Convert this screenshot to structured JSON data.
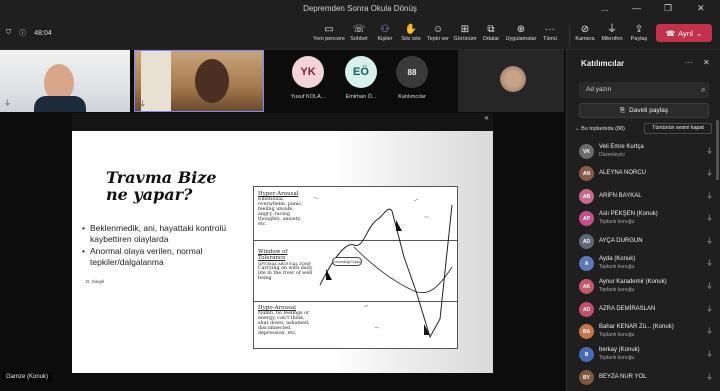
{
  "window": {
    "title": "Depremden Sonra Okula Dönüş",
    "controls": [
      "...",
      "—",
      "❐",
      "✕"
    ]
  },
  "toolbar": {
    "timer": "48:04",
    "items": [
      {
        "label": "Yeni pencere",
        "icon": "new-window-icon"
      },
      {
        "label": "Sohbet",
        "icon": "chat-icon"
      },
      {
        "label": "Kişiler",
        "icon": "people-icon"
      },
      {
        "label": "Söz iste",
        "icon": "raise-hand-icon"
      },
      {
        "label": "Tepki ver",
        "icon": "react-icon"
      },
      {
        "label": "Görünüm",
        "icon": "view-icon"
      },
      {
        "label": "Odalar",
        "icon": "rooms-icon"
      },
      {
        "label": "Uygulamalar",
        "icon": "apps-icon"
      },
      {
        "label": "Tümü",
        "icon": "more-icon"
      },
      {
        "label": "Kamera",
        "icon": "camera-off-icon"
      },
      {
        "label": "Mikrofon",
        "icon": "mic-off-icon"
      },
      {
        "label": "Paylaş",
        "icon": "share-icon"
      }
    ],
    "leave_label": "Ayrıl"
  },
  "video": {
    "tiles": [
      {
        "initials": "YK",
        "name": "Yusuf KOLA...",
        "bg": "#f4d4d8",
        "fg": "#7a2433"
      },
      {
        "initials": "EÖ",
        "name": "Emirhan Ö...",
        "bg": "#d7f0ec",
        "fg": "#1d5e57"
      },
      {
        "initials": "88",
        "name": "Katılımcılar",
        "bg": "#3a3a3a",
        "fg": "#f0f0f0"
      }
    ],
    "speaker_label": "Gamze (Konuk)"
  },
  "slide": {
    "title_line1": "Travma Bize",
    "title_line2": "ne yapar?",
    "bullets": [
      "Beklenmedik, ani, hayattaki kontrolü kaybettiren olaylarda",
      "Anormal olaya verilen, normal tepkiler/dalgalanma"
    ],
    "credit": "D. Siegel",
    "zones": [
      {
        "title": "Hyper-Arousal",
        "text": "Emotional, overwhelm, panic, feeling unsafe, angry, racing thoughts, anxiety, etc."
      },
      {
        "title": "Window of Tolerance",
        "subtitle": "OPTIMAL AROUSAL ZONE",
        "text": "Carrying on with daily life in the river of well being"
      },
      {
        "title": "Hypo-Arousal",
        "text": "Numb, no feelings or energy, can't think, shut down, ashamed, disconnected, depression, etc."
      }
    ],
    "callout": "Grounding/Coping"
  },
  "panel": {
    "title": "Katılımcılar",
    "search_placeholder": "Ad yazın",
    "invite_label": "Daveti paylaş",
    "section_label": "Bu toplantıda (88)",
    "mute_all_label": "Tümünün sesini kapat",
    "participants": [
      {
        "initials": "VK",
        "name": "Veli Emre Kurtça",
        "role": "Düzenleyici",
        "color": "#6b6b6b"
      },
      {
        "initials": "AN",
        "name": "ALEYNA NORCU",
        "role": "",
        "color": "#8a5a4a"
      },
      {
        "initials": "AB",
        "name": "ARİFN BAYKAL",
        "role": "",
        "color": "#c46a8c"
      },
      {
        "initials": "AP",
        "name": "Aslı PEKŞEN (Konuk)",
        "role": "Toplantı konuğu",
        "color": "#c4508a"
      },
      {
        "initials": "AD",
        "name": "AYÇA DURGUN",
        "role": "",
        "color": "#5e6a7a"
      },
      {
        "initials": "A",
        "name": "Ayda (Konuk)",
        "role": "Toplantı konuğu",
        "color": "#5a7bb5"
      },
      {
        "initials": "AK",
        "name": "Aynur Karademir (Konuk)",
        "role": "Toplantı konuğu",
        "color": "#c45a6c"
      },
      {
        "initials": "AD",
        "name": "AZRA DEMİRASLAN",
        "role": "",
        "color": "#c4506a"
      },
      {
        "initials": "BA",
        "name": "Bahar KENAR Zü... (Konuk)",
        "role": "Toplantı konuğu",
        "color": "#c4764a"
      },
      {
        "initials": "B",
        "name": "berkay (Konuk)",
        "role": "Toplantı konuğu",
        "color": "#4a6ab5"
      },
      {
        "initials": "BY",
        "name": "BEYZA NUR YOL",
        "role": "",
        "color": "#7a5a3a"
      }
    ]
  }
}
